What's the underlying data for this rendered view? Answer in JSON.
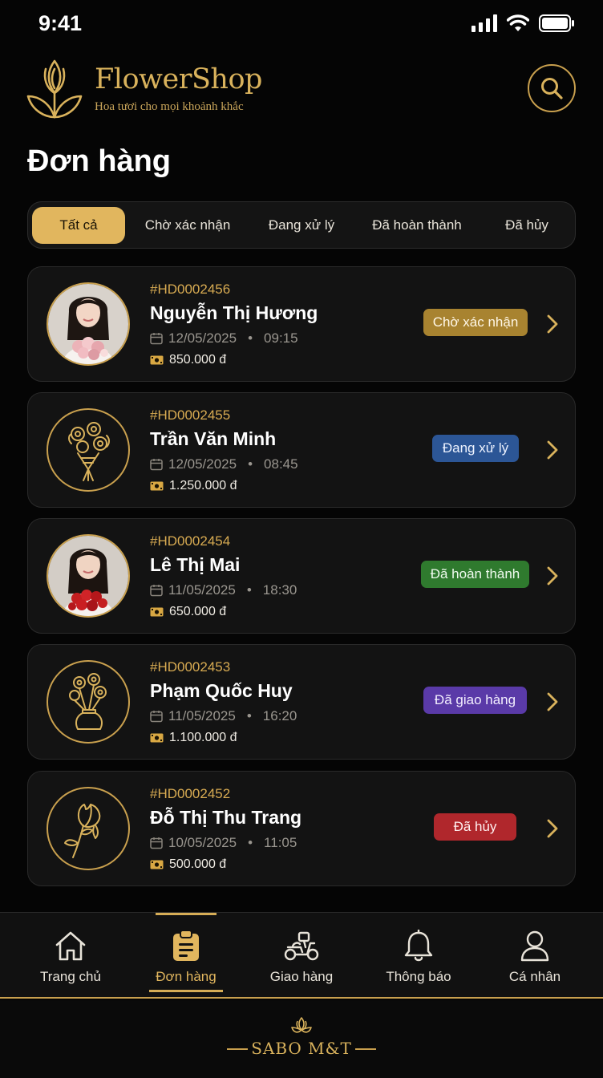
{
  "status_bar": {
    "time": "9:41"
  },
  "brand": {
    "name": "FlowerShop",
    "tagline": "Hoa tươi cho mọi khoảnh khắc"
  },
  "page_title": "Đơn hàng",
  "tabs": [
    {
      "label": "Tất cả",
      "active": true
    },
    {
      "label": "Chờ xác nhận"
    },
    {
      "label": "Đang xử lý"
    },
    {
      "label": "Đã hoàn thành"
    },
    {
      "label": "Đã hủy"
    }
  ],
  "orders": [
    {
      "id": "#HD0002456",
      "name": "Nguyễn Thị Hương",
      "date": "12/05/2025",
      "time": "09:15",
      "price": "850.000 đ",
      "status": "Chờ xác nhận",
      "status_color": "#a88330",
      "avatar": "woman-pink-bouquet-photo"
    },
    {
      "id": "#HD0002455",
      "name": "Trần Văn Minh",
      "date": "12/05/2025",
      "time": "08:45",
      "price": "1.250.000 đ",
      "status": "Đang xử lý",
      "status_color": "#2c5696",
      "avatar": "bouquet-icon"
    },
    {
      "id": "#HD0002454",
      "name": "Lê Thị Mai",
      "date": "11/05/2025",
      "time": "18:30",
      "price": "650.000 đ",
      "status": "Đã hoàn thành",
      "status_color": "#2f7a2e",
      "avatar": "woman-red-roses-photo"
    },
    {
      "id": "#HD0002453",
      "name": "Phạm Quốc Huy",
      "date": "11/05/2025",
      "time": "16:20",
      "price": "1.100.000 đ",
      "status": "Đã giao hàng",
      "status_color": "#5a3aa8",
      "avatar": "flower-vase-icon"
    },
    {
      "id": "#HD0002452",
      "name": "Đỗ Thị Thu Trang",
      "date": "10/05/2025",
      "time": "11:05",
      "price": "500.000 đ",
      "status": "Đã hủy",
      "status_color": "#b0272c",
      "avatar": "tulip-icon"
    }
  ],
  "bottom_nav": [
    {
      "label": "Trang chủ",
      "icon": "home-icon"
    },
    {
      "label": "Đơn hàng",
      "icon": "clipboard-icon",
      "active": true
    },
    {
      "label": "Giao hàng",
      "icon": "scooter-icon"
    },
    {
      "label": "Thông báo",
      "icon": "bell-icon"
    },
    {
      "label": "Cá nhân",
      "icon": "user-icon"
    }
  ],
  "footer": {
    "brand": "SABO M&T"
  },
  "colors": {
    "accent": "#e1b65e",
    "background": "#050505",
    "card": "#131313"
  }
}
